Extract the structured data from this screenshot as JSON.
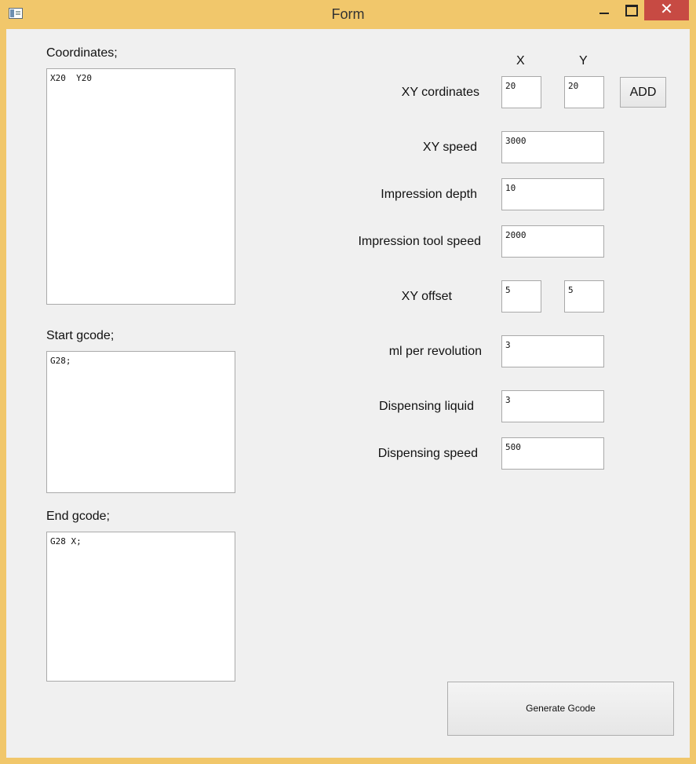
{
  "window": {
    "title": "Form",
    "close_symbol": "✕"
  },
  "left": {
    "coordinates_label": "Coordinates;",
    "coordinates_text": "X20  Y20",
    "start_label": "Start gcode;",
    "start_text": "G28;",
    "end_label": "End gcode;",
    "end_text": "G28 X;"
  },
  "form": {
    "x_header": "X",
    "y_header": "Y",
    "xy_cordinates_label": "XY cordinates",
    "xy_x": "20",
    "xy_y": "20",
    "add_label": "ADD",
    "xy_speed_label": "XY speed",
    "xy_speed": "3000",
    "impression_depth_label": "Impression depth",
    "impression_depth": "10",
    "impression_tool_speed_label": "Impression tool speed",
    "impression_tool_speed": "2000",
    "xy_offset_label": "XY offset",
    "xy_offset_x": "5",
    "xy_offset_y": "5",
    "ml_per_revolution_label": "ml per revolution",
    "ml_per_revolution": "3",
    "dispensing_liquid_label": "Dispensing liquid",
    "dispensing_liquid": "3",
    "dispensing_speed_label": "Dispensing speed",
    "dispensing_speed": "500",
    "generate_label": "Generate Gcode"
  },
  "icons": {
    "app": "window-app-icon",
    "minimize": "minimize-icon",
    "maximize": "maximize-icon",
    "close": "close-icon"
  }
}
